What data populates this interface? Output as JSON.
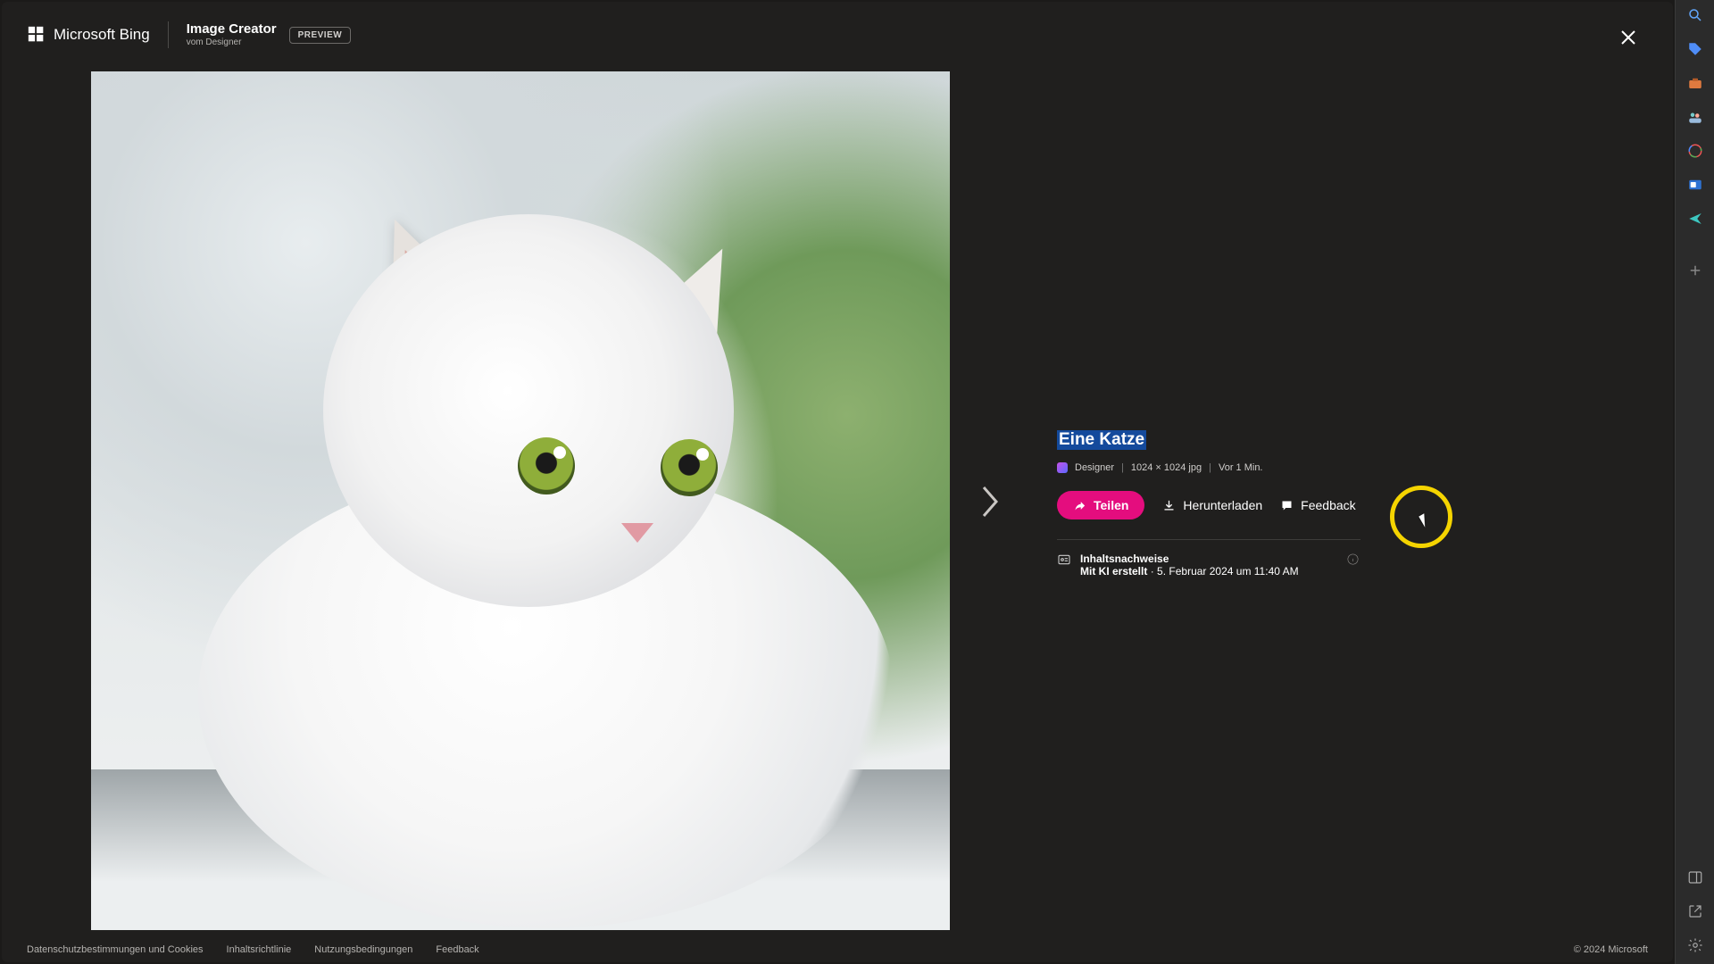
{
  "header": {
    "brand": "Microsoft Bing",
    "product_title": "Image Creator",
    "product_subtitle": "vom Designer",
    "preview_label": "PREVIEW"
  },
  "image": {
    "prompt": "Eine Katze",
    "source_label": "Designer",
    "dimensions": "1024 × 1024 jpg",
    "age": "Vor 1 Min."
  },
  "actions": {
    "share": "Teilen",
    "download": "Herunterladen",
    "feedback": "Feedback"
  },
  "provenance": {
    "heading": "Inhaltsnachweise",
    "ai_label": "Mit KI erstellt",
    "date": "5. Februar 2024 um 11:40 AM"
  },
  "footer": {
    "privacy": "Datenschutzbestimmungen und Cookies",
    "content_policy": "Inhaltsrichtlinie",
    "terms": "Nutzungsbedingungen",
    "feedback": "Feedback",
    "copyright": "© 2024 Microsoft"
  },
  "colors": {
    "accent_share": "#e40d7e",
    "selection_bg": "#144a9c",
    "highlight_ring": "#f5d400"
  }
}
